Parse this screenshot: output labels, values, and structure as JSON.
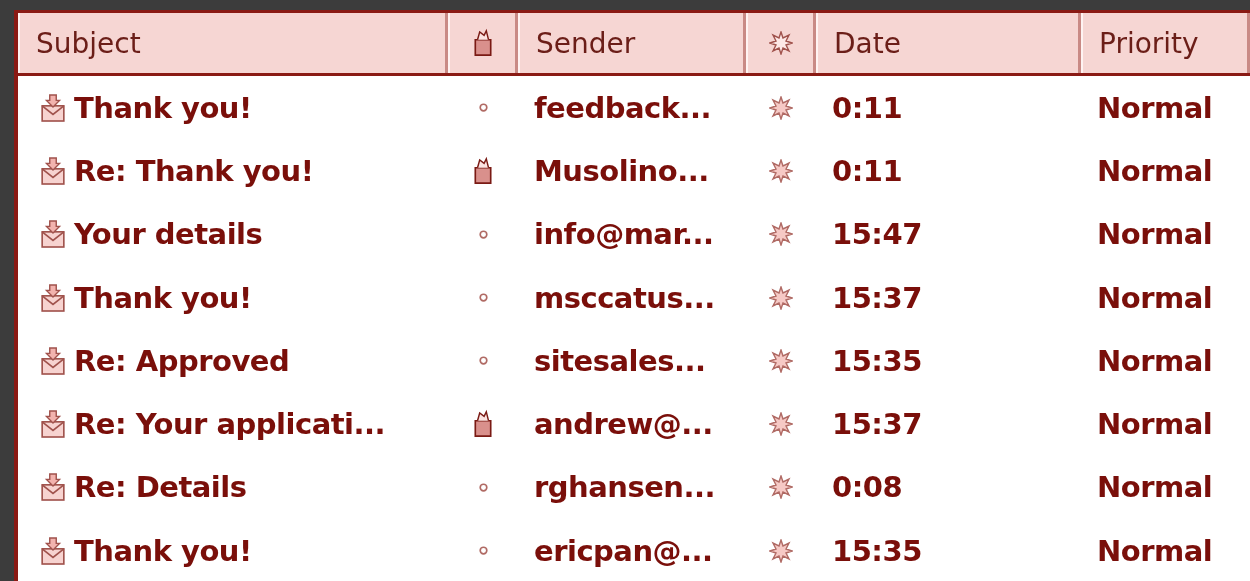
{
  "columns": [
    {
      "kind": "text",
      "label": "Subject"
    },
    {
      "kind": "attachment"
    },
    {
      "kind": "text",
      "label": "Sender"
    },
    {
      "kind": "flag"
    },
    {
      "kind": "text",
      "label": "Date"
    },
    {
      "kind": "text",
      "label": "Priority"
    }
  ],
  "rows": [
    {
      "subject": "Thank you!",
      "attachment": false,
      "sender": "feedback...",
      "date": "0:11",
      "priority": "Normal"
    },
    {
      "subject": "Re: Thank you!",
      "attachment": true,
      "sender": "Musolino...",
      "date": "0:11",
      "priority": "Normal"
    },
    {
      "subject": "Your details",
      "attachment": false,
      "sender": "info@mar...",
      "date": "15:47",
      "priority": "Normal"
    },
    {
      "subject": "Thank you!",
      "attachment": false,
      "sender": "msccatus...",
      "date": "15:37",
      "priority": "Normal"
    },
    {
      "subject": "Re: Approved",
      "attachment": false,
      "sender": "sitesales...",
      "date": "15:35",
      "priority": "Normal"
    },
    {
      "subject": "Re: Your applicati...",
      "attachment": true,
      "sender": "andrew@...",
      "date": "15:37",
      "priority": "Normal"
    },
    {
      "subject": "Re: Details",
      "attachment": false,
      "sender": "rghansen...",
      "date": "0:08",
      "priority": "Normal"
    },
    {
      "subject": "Thank you!",
      "attachment": false,
      "sender": "ericpan@...",
      "date": "15:35",
      "priority": "Normal"
    }
  ]
}
